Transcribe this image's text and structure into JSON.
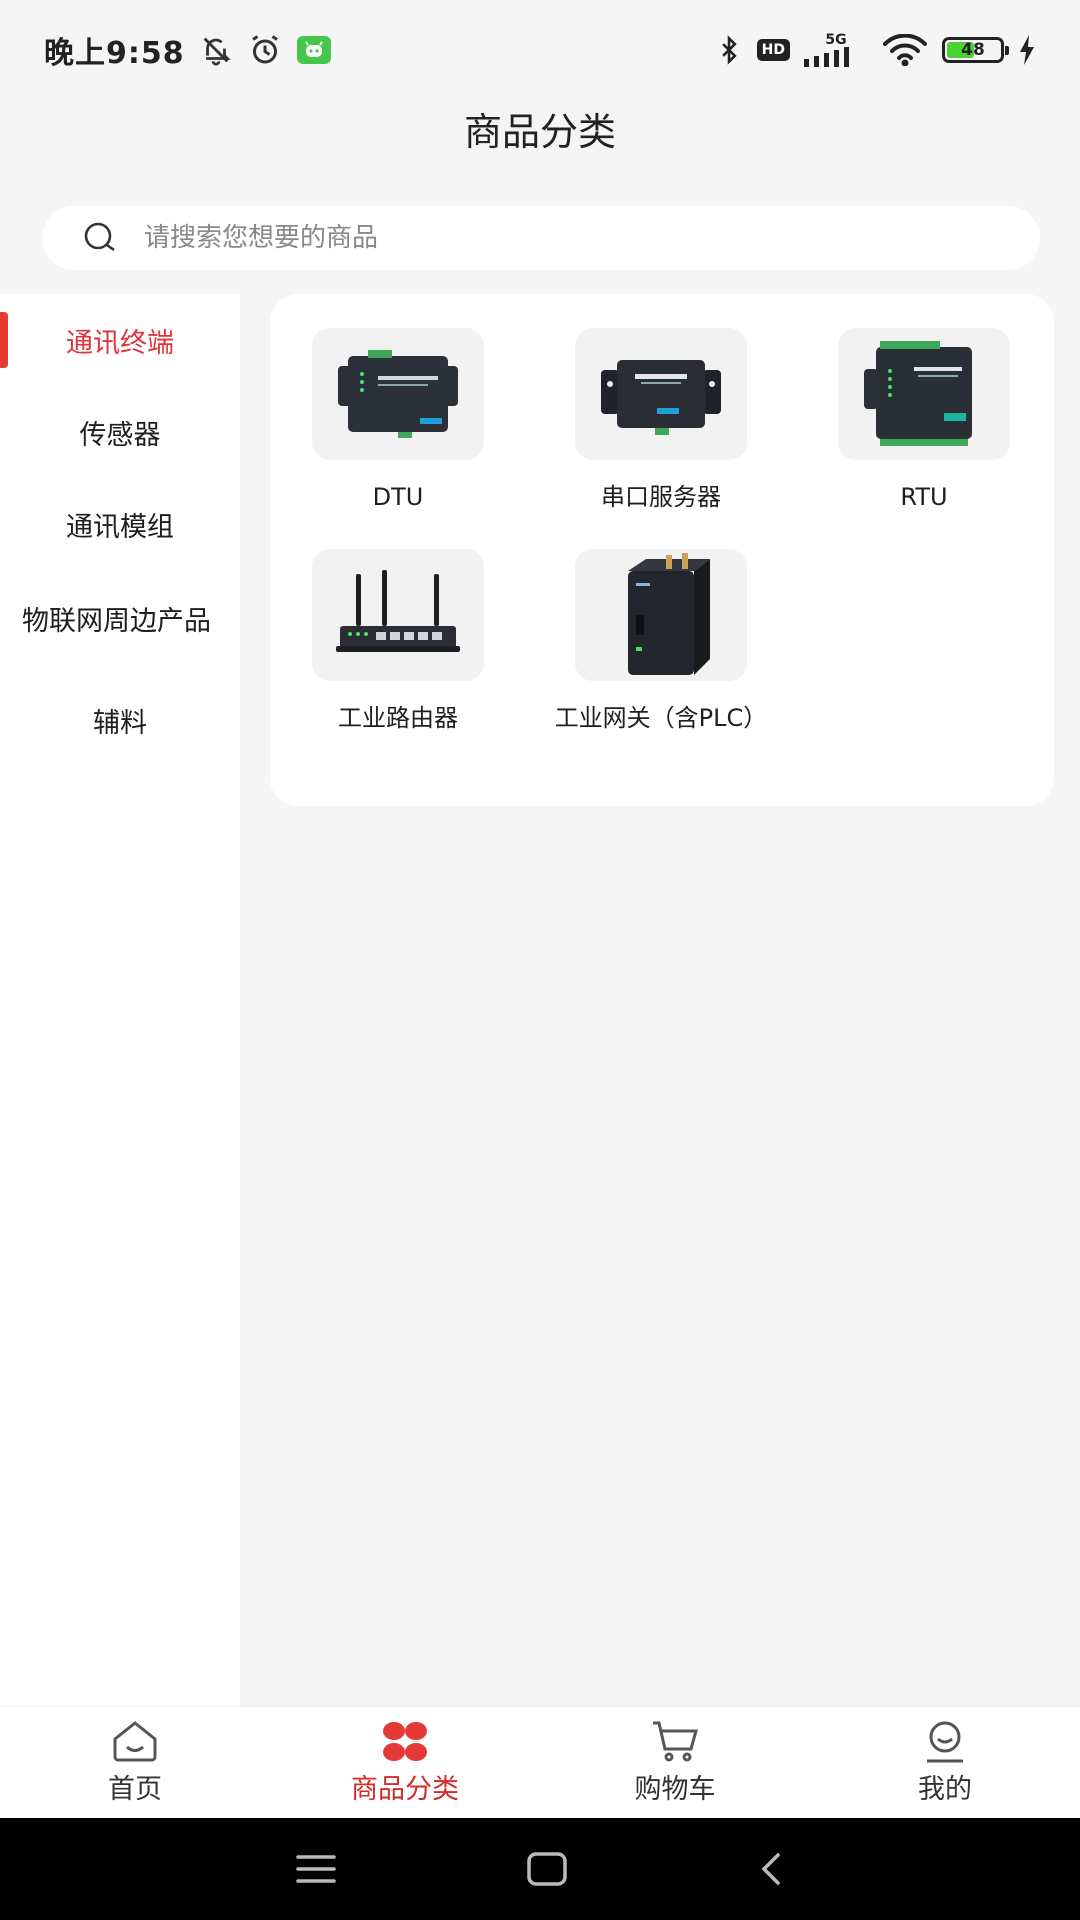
{
  "status_bar": {
    "time": "晚上9:58",
    "network_label": "5G",
    "hd_label": "HD",
    "battery_level": "48",
    "icons": [
      "bell-muted-icon",
      "alarm-icon",
      "app-notification-icon",
      "bluetooth-icon",
      "signal-icon",
      "wifi-icon",
      "charging-icon"
    ]
  },
  "header": {
    "title": "商品分类"
  },
  "search": {
    "placeholder": "请搜索您想要的商品",
    "value": ""
  },
  "sidebar": {
    "active_index": 0,
    "items": [
      {
        "label": "通讯终端"
      },
      {
        "label": "传感器"
      },
      {
        "label": "通讯模组"
      },
      {
        "label": "物联网周边产品"
      },
      {
        "label": "辅料"
      }
    ]
  },
  "products": [
    {
      "label": "DTU",
      "image": "dtu-device"
    },
    {
      "label": "串口服务器",
      "image": "serial-server-device"
    },
    {
      "label": "RTU",
      "image": "rtu-device"
    },
    {
      "label": "工业路由器",
      "image": "industrial-router-device"
    },
    {
      "label": "工业网关（含PLC）",
      "image": "industrial-gateway-device"
    }
  ],
  "bottom_nav": {
    "active_index": 1,
    "items": [
      {
        "label": "首页",
        "icon": "home-icon"
      },
      {
        "label": "商品分类",
        "icon": "category-icon"
      },
      {
        "label": "购物车",
        "icon": "cart-icon"
      },
      {
        "label": "我的",
        "icon": "profile-icon"
      }
    ]
  },
  "colors": {
    "accent": "#e0353b",
    "background": "#f5f5f5",
    "card": "#ffffff"
  }
}
